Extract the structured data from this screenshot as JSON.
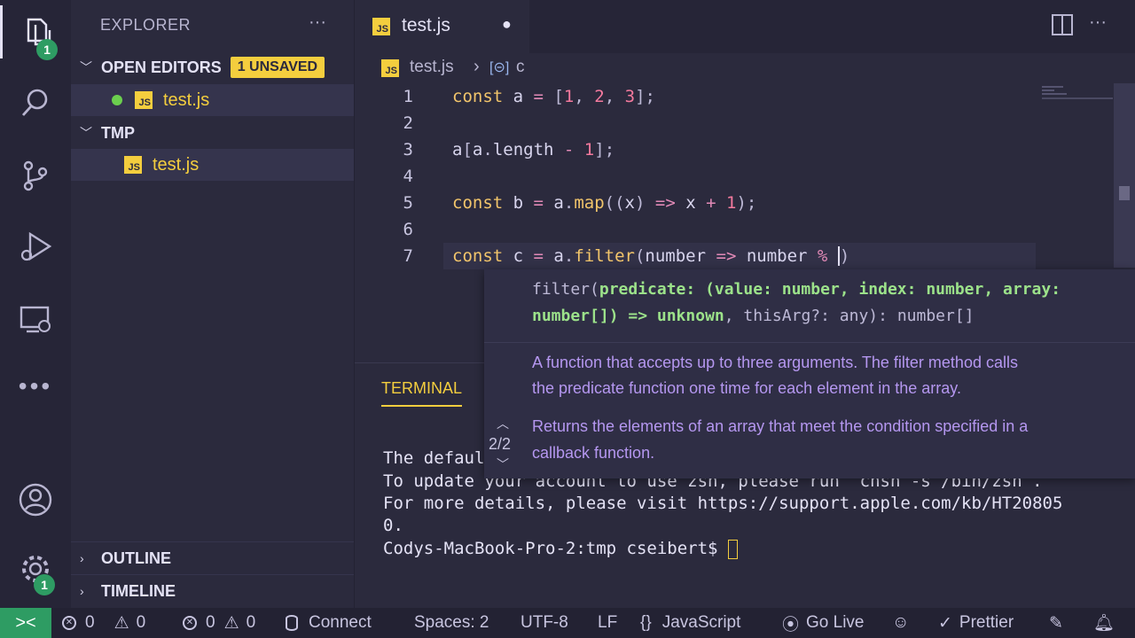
{
  "activity": {
    "explorer_badge": "1",
    "settings_badge": "1"
  },
  "sidebar": {
    "title": "EXPLORER",
    "more": "···",
    "open_editors": {
      "label": "OPEN EDITORS",
      "badge": "1 UNSAVED",
      "file": "test.js"
    },
    "folder": {
      "label": "TMP",
      "file": "test.js"
    },
    "outline": "OUTLINE",
    "timeline": "TIMELINE",
    "js_icon_text": "JS"
  },
  "tab": {
    "label": "test.js",
    "dirty_dot": "●"
  },
  "breadcrumb": {
    "file": "test.js",
    "sep": "›",
    "symbol": "c"
  },
  "editor": {
    "line_numbers": [
      "1",
      "2",
      "3",
      "4",
      "5",
      "6",
      "7"
    ]
  },
  "hover": {
    "signature_line1": "filter(predicate: (value: number, index: number, array:",
    "signature_line2": "number[]) => unknown, thisArg?: any): number[]",
    "doc_line1": "A function that accepts up to three arguments. The filter method calls",
    "doc_line2": "the predicate function one time for each element in the array.",
    "doc_line3": "Returns the elements of an array that meet the condition specified in a",
    "doc_line4": "callback function.",
    "overload": "2/2"
  },
  "terminal": {
    "tab_label": "TERMINAL",
    "line1": "The defaul",
    "line2": "To update your account to use zsh, please run `chsh -s /bin/zsh`.",
    "line3": "For more details, please visit https://support.apple.com/kb/HT20805",
    "line4": "0.",
    "prompt": "Codys-MacBook-Pro-2:tmp cseibert$ "
  },
  "status": {
    "errors": "0",
    "warnings": "0",
    "errors2": "0",
    "warnings2": "0",
    "connect": "Connect",
    "spaces": "Spaces: 2",
    "encoding": "UTF-8",
    "eol": "LF",
    "language": "JavaScript",
    "golive": "Go Live",
    "prettier": "Prettier"
  },
  "colors": {
    "accent": "#f4ce3e",
    "remote": "#2e9c63",
    "background": "#2b2a3d"
  }
}
